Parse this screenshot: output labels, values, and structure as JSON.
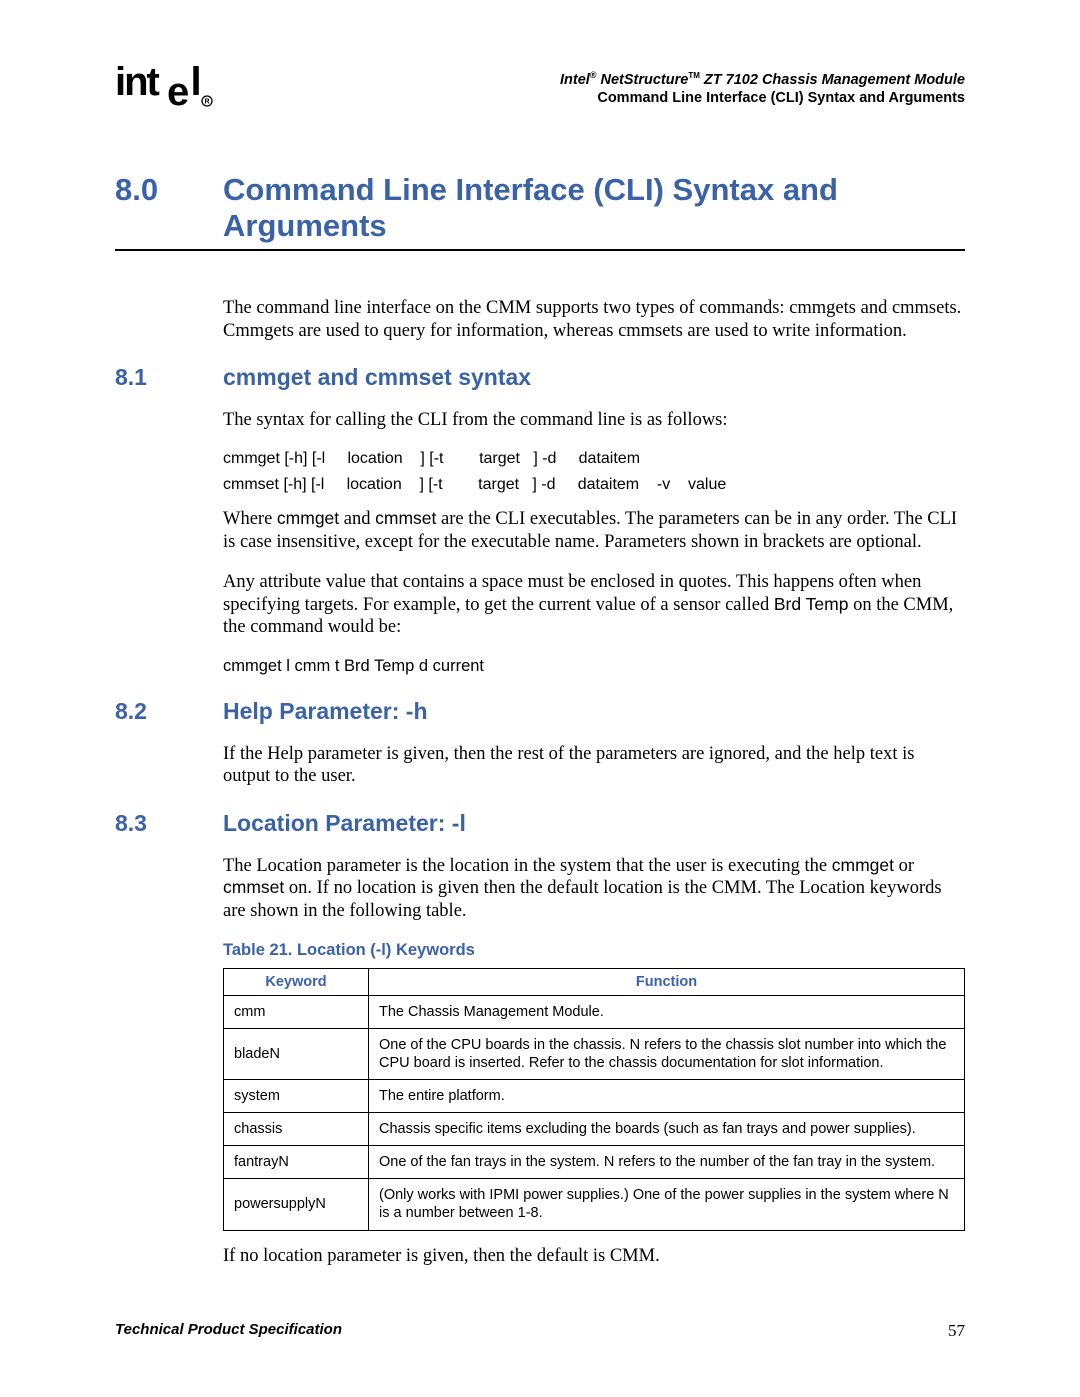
{
  "header": {
    "product_line": "Intel® NetStructure™ ZT 7102 Chassis Management Module",
    "subtitle": "Command Line Interface (CLI) Syntax and Arguments"
  },
  "chapter": {
    "num": "8.0",
    "title": "Command Line Interface (CLI) Syntax and Arguments"
  },
  "intro": "The command line interface on the CMM supports two types of commands: cmmgets and cmmsets. Cmmgets are used to query for information, whereas cmmsets are used to write information.",
  "s81": {
    "num": "8.1",
    "title": "cmmget and cmmset syntax",
    "p1": "The syntax for calling the CLI from the command line is as follows:",
    "syntax1": "cmmget [-h] [-l     location    ] [-t        target   ] -d     dataitem",
    "syntax2": "cmmset [-h] [-l     location    ] [-t        target   ] -d     dataitem    -v    value",
    "p2_a": "Where ",
    "p2_b": "cmmget",
    "p2_c": " and ",
    "p2_d": "cmmset",
    "p2_e": " are the CLI executables. The parameters can be in any order. The CLI is case insensitive, except for the executable name. Parameters shown in brackets are optional.",
    "p3_a": "Any attribute value that contains a space must be enclosed in quotes. This happens often when specifying targets. For example, to get the current value of a sensor called ",
    "p3_b": "Brd Temp",
    "p3_c": " on the CMM, the command would be:",
    "example": "cmmget  l cmm  t  Brd Temp   d current"
  },
  "s82": {
    "num": "8.2",
    "title": "Help Parameter: -h",
    "p1": "If the Help parameter is given, then the rest of the parameters are ignored, and the help text is output to the user."
  },
  "s83": {
    "num": "8.3",
    "title": "Location Parameter: -l",
    "p1_a": "The Location parameter is the location in the system that the user is executing the ",
    "p1_b": "cmmget",
    "p1_c": " or ",
    "p1_d": "cmmset",
    "p1_e": " on. If no location is given then the default location is the CMM. The Location keywords are shown in the following table.",
    "table_caption": "Table 21. Location (-l) Keywords",
    "th1": "Keyword",
    "th2": "Function",
    "rows": [
      {
        "k": "cmm",
        "f": "The Chassis Management Module."
      },
      {
        "k": "bladeN",
        "f": "One of the CPU boards in the chassis. N refers to the chassis slot number into which the CPU board is inserted. Refer to the chassis documentation for slot information."
      },
      {
        "k": "system",
        "f": "The entire platform."
      },
      {
        "k": "chassis",
        "f": "Chassis specific items excluding the boards (such as fan trays and power supplies)."
      },
      {
        "k": "fantrayN",
        "f": "One of the fan trays in the system. N refers to the number of the fan tray in the system."
      },
      {
        "k": "powersupplyN",
        "f": "(Only works with IPMI power supplies.) One of the power supplies in the system where N is a number between 1-8."
      }
    ],
    "p2": "If no location parameter is given, then the default is CMM."
  },
  "footer": {
    "left": "Technical Product Specification",
    "page": "57"
  }
}
